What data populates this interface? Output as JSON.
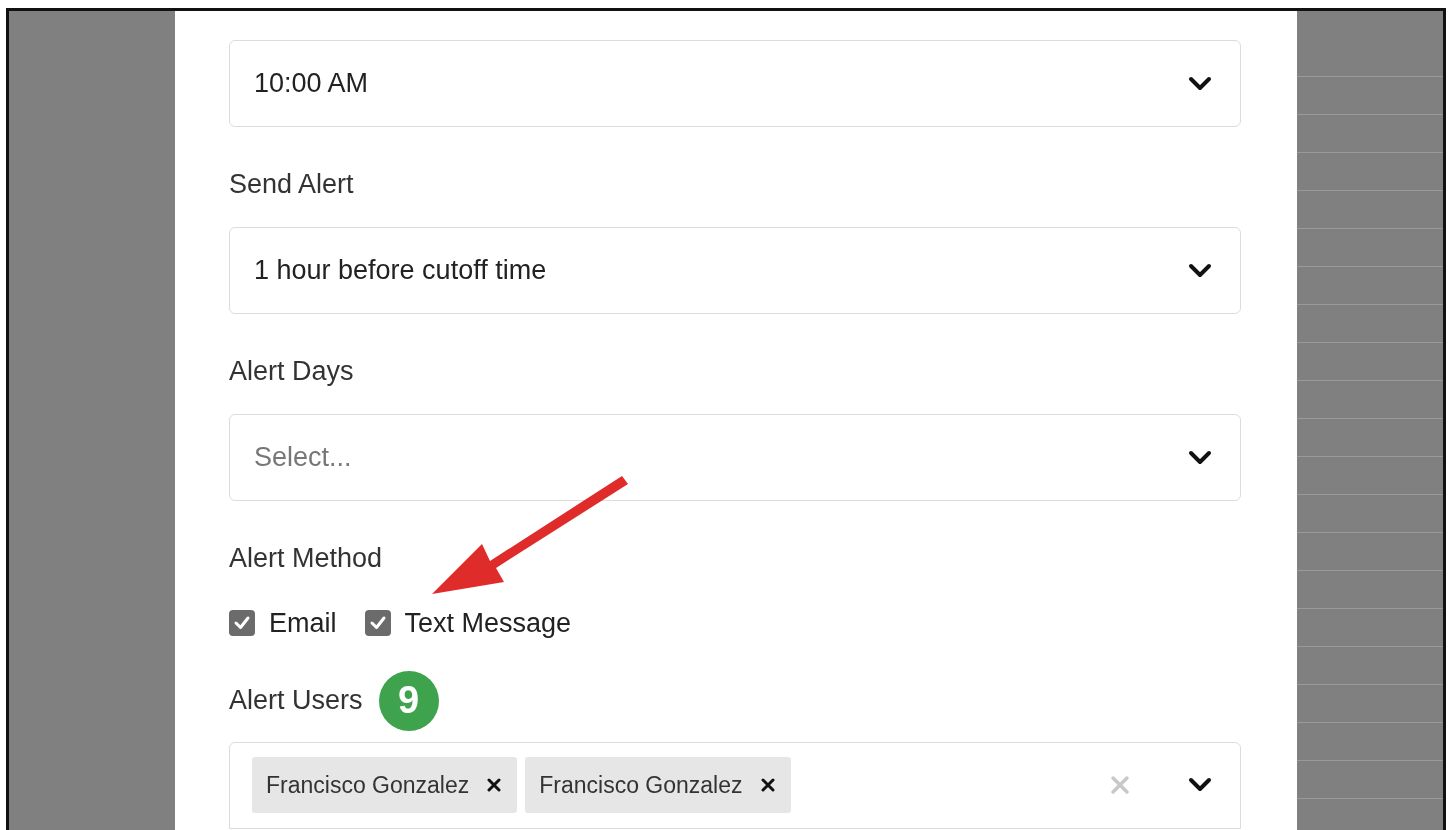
{
  "fields": [
    {
      "kind": "select",
      "value": "10:00 AM"
    },
    {
      "kind": "select",
      "label": "Send Alert",
      "value": "1 hour before cutoff time"
    },
    {
      "kind": "select",
      "label": "Alert Days",
      "placeholder": "Select..."
    },
    {
      "kind": "checkboxes",
      "label": "Alert Method",
      "options": [
        {
          "label": "Email",
          "checked": true
        },
        {
          "label": "Text Message",
          "checked": true
        }
      ]
    },
    {
      "kind": "multiselect",
      "label": "Alert Users",
      "step_badge": "9",
      "tags": [
        "Francisco Gonzalez",
        "Francisco Gonzalez"
      ]
    }
  ]
}
